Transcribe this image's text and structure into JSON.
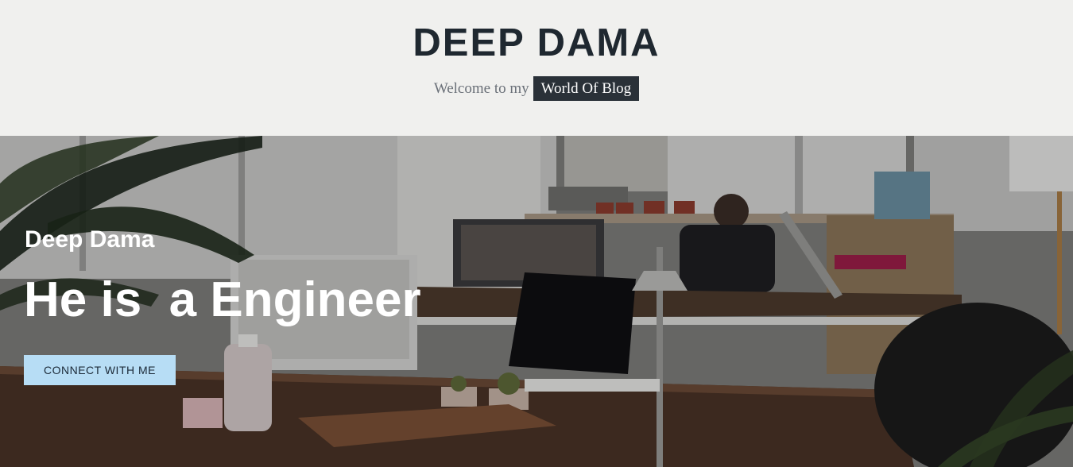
{
  "header": {
    "site_title": "DEEP DAMA",
    "tagline_prefix": "Welcome to my",
    "tagline_highlight": "World Of Blog"
  },
  "hero": {
    "subtitle": "Deep Dama",
    "heading": "He is  a Engineer",
    "cta_label": "CONNECT WITH ME"
  },
  "colors": {
    "header_bg": "#f0f0ee",
    "title_text": "#1f2830",
    "badge_bg": "#2a3138",
    "cta_bg": "#b7ddf5"
  }
}
